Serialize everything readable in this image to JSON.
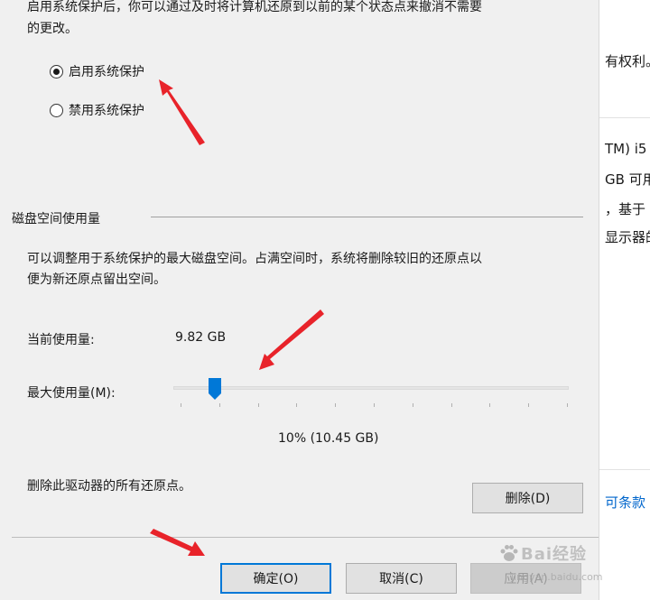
{
  "dialog": {
    "intro_line1": "启用系统保护后，你可以通过及时将计算机还原到以前的某个状态点来撤消不需要",
    "intro_line2": "的更改。",
    "radio_enable": {
      "label": "启用系统保护",
      "selected": true
    },
    "radio_disable": {
      "label": "禁用系统保护",
      "selected": false
    },
    "disk_group": {
      "title": "磁盘空间使用量",
      "desc_line1": "可以调整用于系统保护的最大磁盘空间。占满空间时，系统将删除较旧的还原点以",
      "desc_line2": "便为新还原点留出空间。",
      "current_usage_label": "当前使用量:",
      "current_usage_value": "9.82 GB",
      "max_usage_label": "最大使用量(M):",
      "slider_percent": 10,
      "slider_value_text": "10% (10.45 GB)"
    },
    "delete_text": "删除此驱动器的所有还原点。",
    "delete_button": "删除(D)",
    "buttons": {
      "ok": "确定(O)",
      "cancel": "取消(C)",
      "apply": "应用(A)"
    },
    "accent_color": "#0078d7",
    "annotation_color": "#e8232a"
  },
  "background_window": {
    "frag1": "有权利。",
    "frag2": "TM) i5",
    "frag3": "GB 可用",
    "frag4": "，基于",
    "frag5": "显示器的",
    "link": "可条款"
  },
  "watermark": {
    "text": "Bai经验",
    "sub": "jingyan.baidu.com"
  }
}
